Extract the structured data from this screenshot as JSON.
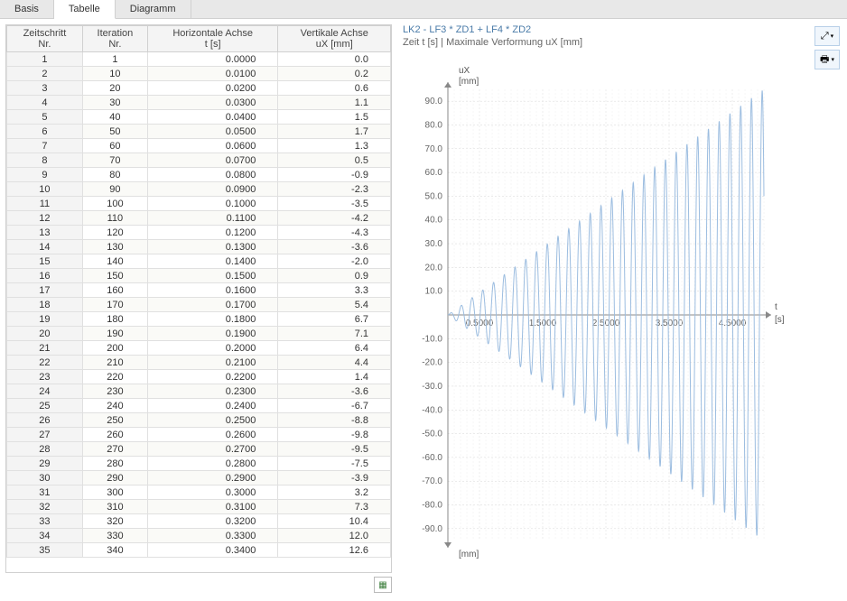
{
  "tabs": {
    "basis": "Basis",
    "tabelle": "Tabelle",
    "diagramm": "Diagramm"
  },
  "table": {
    "headers": {
      "col1a": "Zeitschritt",
      "col1b": "Nr.",
      "col2a": "Iteration",
      "col2b": "Nr.",
      "col3a": "Horizontale Achse",
      "col3b": "t [s]",
      "col4a": "Vertikale Achse",
      "col4b": "uX [mm]"
    },
    "rows": [
      {
        "n": 1,
        "it": 1,
        "t": "0.0000",
        "ux": "0.0"
      },
      {
        "n": 2,
        "it": 10,
        "t": "0.0100",
        "ux": "0.2"
      },
      {
        "n": 3,
        "it": 20,
        "t": "0.0200",
        "ux": "0.6"
      },
      {
        "n": 4,
        "it": 30,
        "t": "0.0300",
        "ux": "1.1"
      },
      {
        "n": 5,
        "it": 40,
        "t": "0.0400",
        "ux": "1.5"
      },
      {
        "n": 6,
        "it": 50,
        "t": "0.0500",
        "ux": "1.7"
      },
      {
        "n": 7,
        "it": 60,
        "t": "0.0600",
        "ux": "1.3"
      },
      {
        "n": 8,
        "it": 70,
        "t": "0.0700",
        "ux": "0.5"
      },
      {
        "n": 9,
        "it": 80,
        "t": "0.0800",
        "ux": "-0.9"
      },
      {
        "n": 10,
        "it": 90,
        "t": "0.0900",
        "ux": "-2.3"
      },
      {
        "n": 11,
        "it": 100,
        "t": "0.1000",
        "ux": "-3.5"
      },
      {
        "n": 12,
        "it": 110,
        "t": "0.1100",
        "ux": "-4.2"
      },
      {
        "n": 13,
        "it": 120,
        "t": "0.1200",
        "ux": "-4.3"
      },
      {
        "n": 14,
        "it": 130,
        "t": "0.1300",
        "ux": "-3.6"
      },
      {
        "n": 15,
        "it": 140,
        "t": "0.1400",
        "ux": "-2.0"
      },
      {
        "n": 16,
        "it": 150,
        "t": "0.1500",
        "ux": "0.9"
      },
      {
        "n": 17,
        "it": 160,
        "t": "0.1600",
        "ux": "3.3"
      },
      {
        "n": 18,
        "it": 170,
        "t": "0.1700",
        "ux": "5.4"
      },
      {
        "n": 19,
        "it": 180,
        "t": "0.1800",
        "ux": "6.7"
      },
      {
        "n": 20,
        "it": 190,
        "t": "0.1900",
        "ux": "7.1"
      },
      {
        "n": 21,
        "it": 200,
        "t": "0.2000",
        "ux": "6.4"
      },
      {
        "n": 22,
        "it": 210,
        "t": "0.2100",
        "ux": "4.4"
      },
      {
        "n": 23,
        "it": 220,
        "t": "0.2200",
        "ux": "1.4"
      },
      {
        "n": 24,
        "it": 230,
        "t": "0.2300",
        "ux": "-3.6"
      },
      {
        "n": 25,
        "it": 240,
        "t": "0.2400",
        "ux": "-6.7"
      },
      {
        "n": 26,
        "it": 250,
        "t": "0.2500",
        "ux": "-8.8"
      },
      {
        "n": 27,
        "it": 260,
        "t": "0.2600",
        "ux": "-9.8"
      },
      {
        "n": 28,
        "it": 270,
        "t": "0.2700",
        "ux": "-9.5"
      },
      {
        "n": 29,
        "it": 280,
        "t": "0.2800",
        "ux": "-7.5"
      },
      {
        "n": 30,
        "it": 290,
        "t": "0.2900",
        "ux": "-3.9"
      },
      {
        "n": 31,
        "it": 300,
        "t": "0.3000",
        "ux": "3.2"
      },
      {
        "n": 32,
        "it": 310,
        "t": "0.3100",
        "ux": "7.3"
      },
      {
        "n": 33,
        "it": 320,
        "t": "0.3200",
        "ux": "10.4"
      },
      {
        "n": 34,
        "it": 330,
        "t": "0.3300",
        "ux": "12.0"
      },
      {
        "n": 35,
        "it": 340,
        "t": "0.3400",
        "ux": "12.6"
      }
    ]
  },
  "chart": {
    "title": "LK2 - LF3 * ZD1 + LF4 * ZD2",
    "subtitle": "Zeit t [s] | Maximale Verformung uX [mm]",
    "y_label_top": "uX",
    "y_label_top2": "[mm]",
    "y_label_bottom": "[mm]",
    "x_label": "t",
    "x_label2": "[s]",
    "y_ticks": [
      "90.0",
      "80.0",
      "70.0",
      "60.0",
      "50.0",
      "40.0",
      "30.0",
      "20.0",
      "10.0",
      "-10.0",
      "-20.0",
      "-30.0",
      "-40.0",
      "-50.0",
      "-60.0",
      "-70.0",
      "-80.0",
      "-90.0"
    ],
    "x_ticks": [
      "0.5000",
      "1.5000",
      "2.5000",
      "3.5000",
      "4.5000"
    ]
  },
  "chart_data": {
    "type": "line",
    "title": "LK2 - LF3 * ZD1 + LF4 * ZD2",
    "xlabel": "t [s]",
    "ylabel": "uX [mm]",
    "xlim": [
      0,
      5
    ],
    "ylim": [
      -95,
      95
    ],
    "description": "Resonance / growing amplitude oscillation. Period ~0.17s, amplitude grows roughly linearly from ~2mm at t=0.05s to ~95mm at t=5s.",
    "params": {
      "period": 0.17,
      "t_max": 5.0,
      "amp_at_tmax": 95
    }
  }
}
